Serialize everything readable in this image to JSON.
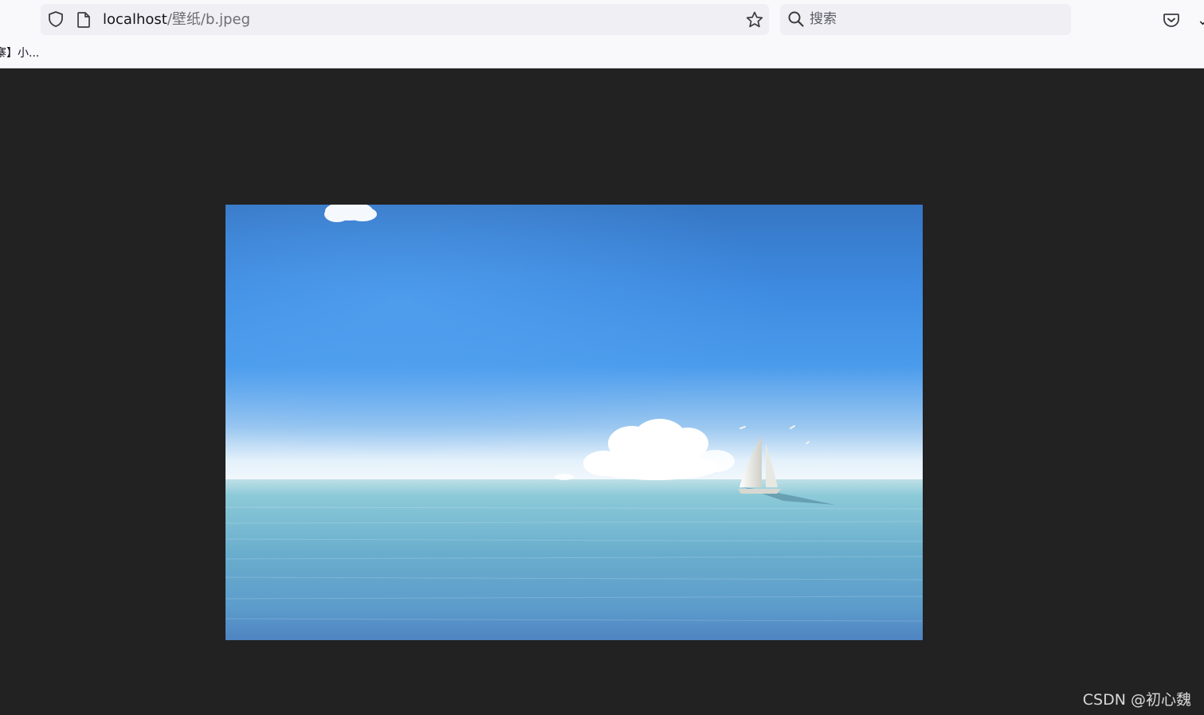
{
  "browser": {
    "url_host": "localhost",
    "url_path": "/壁纸/b.jpeg",
    "search_placeholder": "搜索",
    "bookmark_label": "寨】小..."
  },
  "image": {
    "description": "sailboat-on-sea-wallpaper"
  },
  "watermark": "CSDN @初心魏",
  "colors": {
    "toolbar_bg": "#f9f9fb",
    "field_bg": "#f0f0f4",
    "viewer_bg": "#222222",
    "sky_top": "#3779c6",
    "sky_mid": "#3e92e6",
    "sea": "#6aadcb"
  },
  "icons": [
    "shield-icon",
    "page-icon",
    "bookmark-star-icon",
    "search-icon",
    "pocket-icon"
  ]
}
